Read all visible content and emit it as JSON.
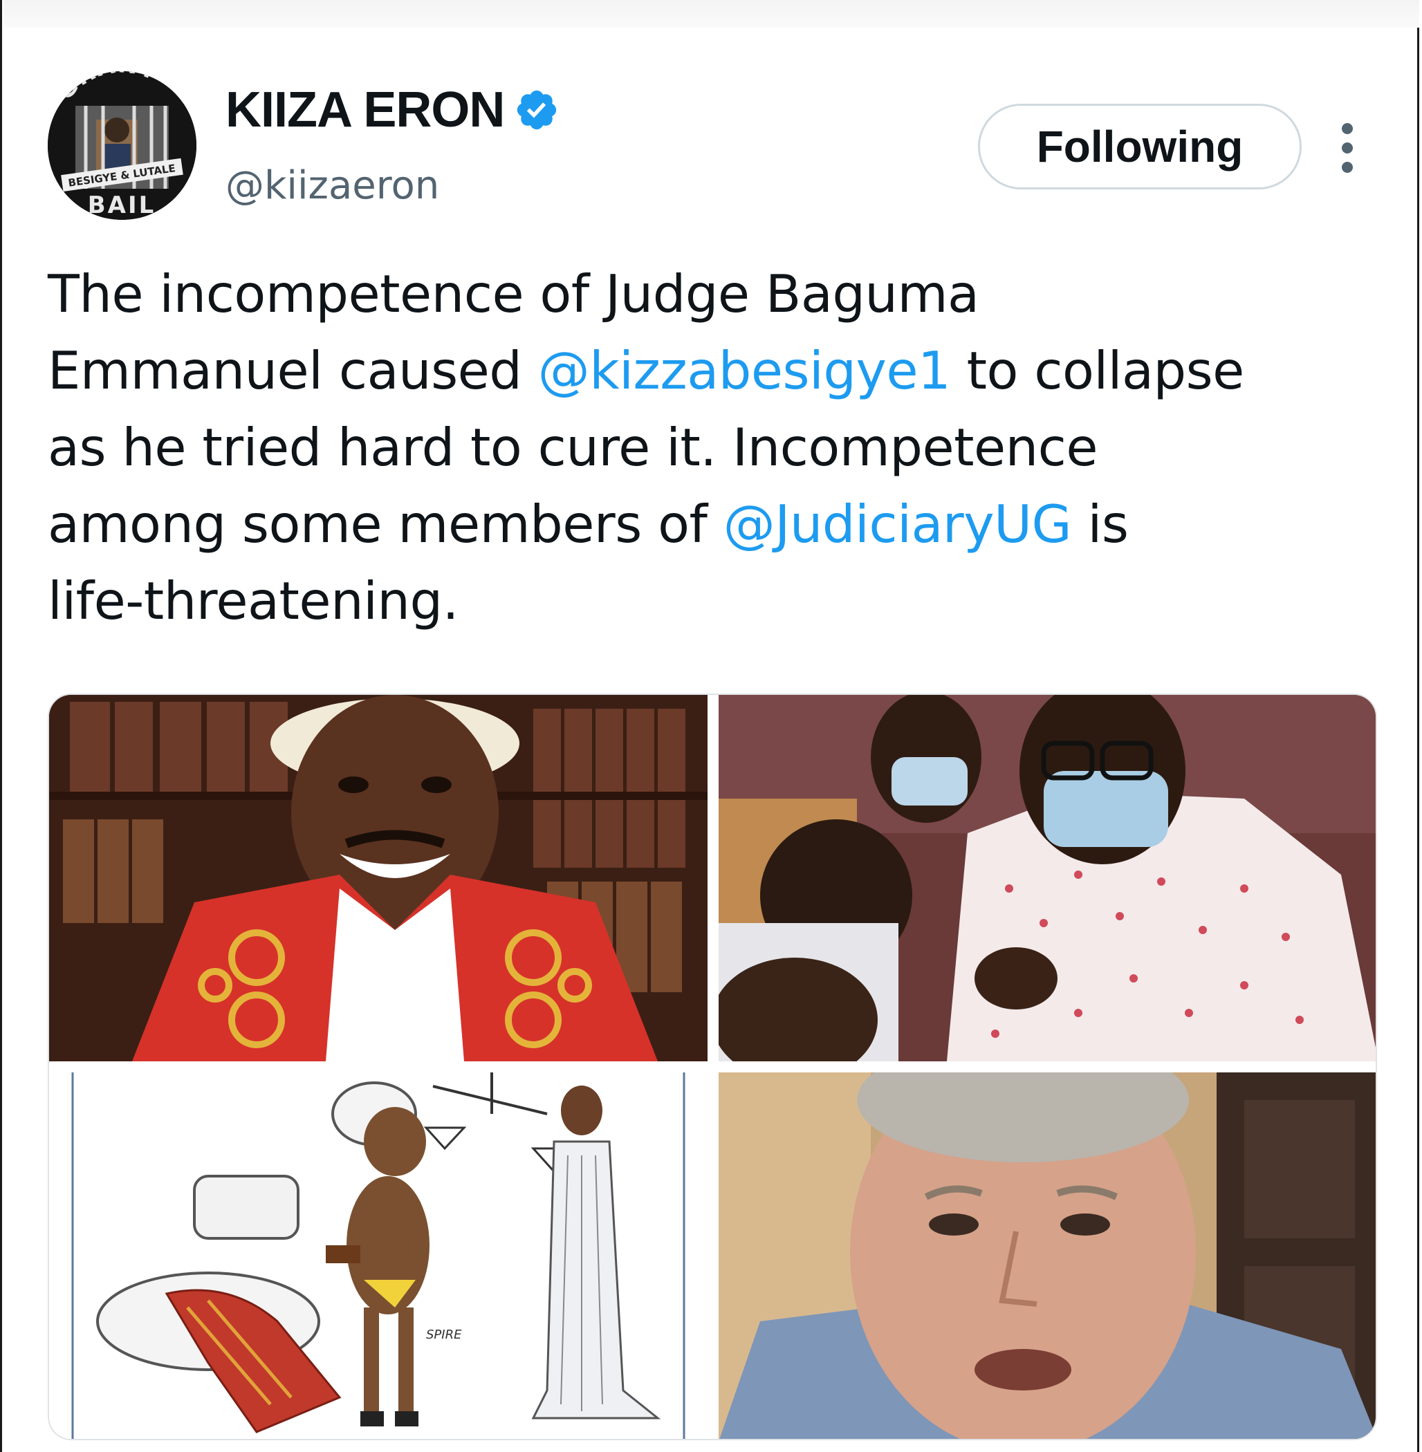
{
  "tweet": {
    "author": {
      "display_name": "KIIZA ERON",
      "handle": "@kiizaeron",
      "verified": true,
      "avatar_text_top": "GRANT",
      "avatar_text_banner": "BESIGYE & LUTALE",
      "avatar_text_bottom": "BAIL"
    },
    "follow_button_label": "Following",
    "more_icon": "more-vertical-icon",
    "text": {
      "line1": "The incompetence of Judge Baguma",
      "line2_before": "Emmanuel caused ",
      "line2_mention": "@kizzabesigye1",
      "line2_after": " to collapse",
      "line3": "as he tried hard to cure it. Incompetence",
      "line4_before": "among some members of ",
      "line4_mention": "@JudiciaryUG",
      "line4_after": " is",
      "line5": "life-threatening."
    },
    "media": [
      {
        "name": "photo-judge-in-red-robe"
      },
      {
        "name": "photo-man-in-mask-floral-shirt"
      },
      {
        "name": "cartoon-judge-toilet-justice",
        "signature": "SPIRE"
      },
      {
        "name": "photo-man-closeup"
      }
    ]
  },
  "colors": {
    "accent": "#1d9bf0",
    "text": "#0f1419",
    "secondary": "#536471",
    "border": "#cfd9de"
  }
}
